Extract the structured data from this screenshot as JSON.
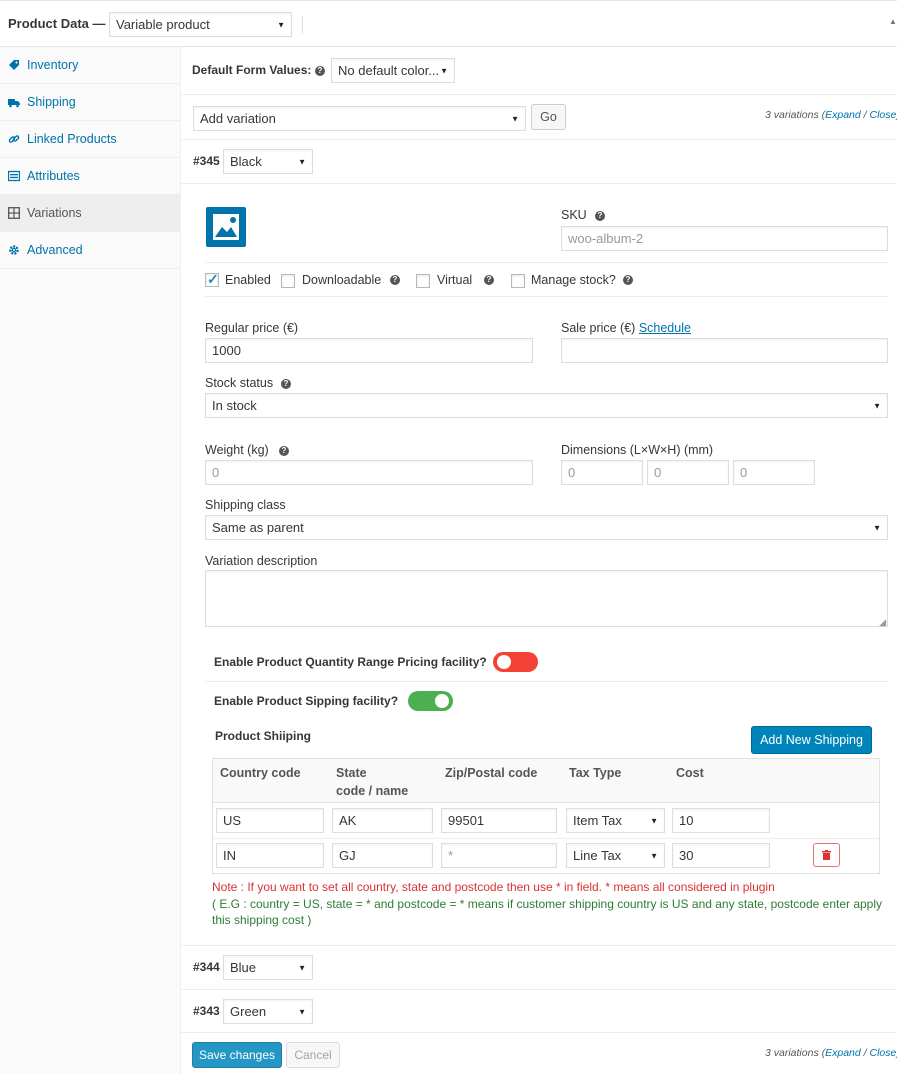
{
  "header": {
    "title": "Product Data —",
    "product_type": "Variable product"
  },
  "sidebar": {
    "items": [
      {
        "label": "Inventory",
        "icon": "tag-icon"
      },
      {
        "label": "Shipping",
        "icon": "truck-icon"
      },
      {
        "label": "Linked Products",
        "icon": "link-icon"
      },
      {
        "label": "Attributes",
        "icon": "list-icon"
      },
      {
        "label": "Variations",
        "icon": "grid-icon"
      },
      {
        "label": "Advanced",
        "icon": "gear-icon"
      }
    ]
  },
  "defaults": {
    "label": "Default Form Values:",
    "help": "?",
    "select_value": "No default color..."
  },
  "variation_toolbar": {
    "select_value": "Add variation",
    "go_label": "Go",
    "count_text": "3 variations (",
    "expand": "Expand",
    "sep": " / ",
    "close": "Close",
    "end": ")"
  },
  "variation_345": {
    "id": "#345",
    "color": "Black",
    "sku_label": "SKU",
    "sku_placeholder": "woo-album-2",
    "checks": {
      "enabled": "Enabled",
      "downloadable": "Downloadable",
      "virtual": "Virtual",
      "manage_stock": "Manage stock?"
    },
    "regular_price_label": "Regular price (€)",
    "regular_price_value": "1000",
    "sale_price_label": "Sale price (€) ",
    "schedule_link": "Schedule",
    "stock_status_label": "Stock status",
    "stock_status_value": "In stock",
    "weight_label": "Weight (kg)",
    "weight_placeholder": "0",
    "dimensions_label": "Dimensions (L×W×H) (mm)",
    "dim_l": "0",
    "dim_w": "0",
    "dim_h": "0",
    "shipping_class_label": "Shipping class",
    "shipping_class_value": "Same as parent",
    "description_label": "Variation description"
  },
  "plugin": {
    "range_pricing_label": "Enable Product Quantity Range Pricing facility?",
    "range_pricing_on": false,
    "shipping_label": "Enable Product Sipping facility?",
    "shipping_on": true,
    "product_shipping_title": "Product Shiiping",
    "add_button": "Add New Shipping",
    "columns": {
      "country": "Country code",
      "state_1": "State",
      "state_2": "code / name",
      "zip": "Zip/Postal code",
      "tax": "Tax Type",
      "cost": "Cost"
    },
    "rows": [
      {
        "country": "US",
        "state": "AK",
        "zip": "99501",
        "tax": "Item Tax",
        "cost": "10"
      },
      {
        "country": "IN",
        "state": "GJ",
        "zip": "*",
        "tax": "Line Tax",
        "cost": "30"
      }
    ],
    "note_red": "Note : If you want to set all country, state and postcode then use * in field. * means all considered in plugin",
    "note_green": "( E.G : country = US, state = * and postcode = * means if customer shipping country is US and any state, postcode enter apply this shipping cost )"
  },
  "variation_344": {
    "id": "#344",
    "color": "Blue"
  },
  "variation_343": {
    "id": "#343",
    "color": "Green"
  },
  "footer": {
    "save_label": "Save changes",
    "cancel_label": "Cancel"
  },
  "colors": {
    "accent": "#0073aa",
    "primary_button": "#0085ba",
    "toggle_off": "#f44336",
    "toggle_on": "#4caf50",
    "note_red": "#dc3232",
    "note_green": "#2e7d32"
  }
}
